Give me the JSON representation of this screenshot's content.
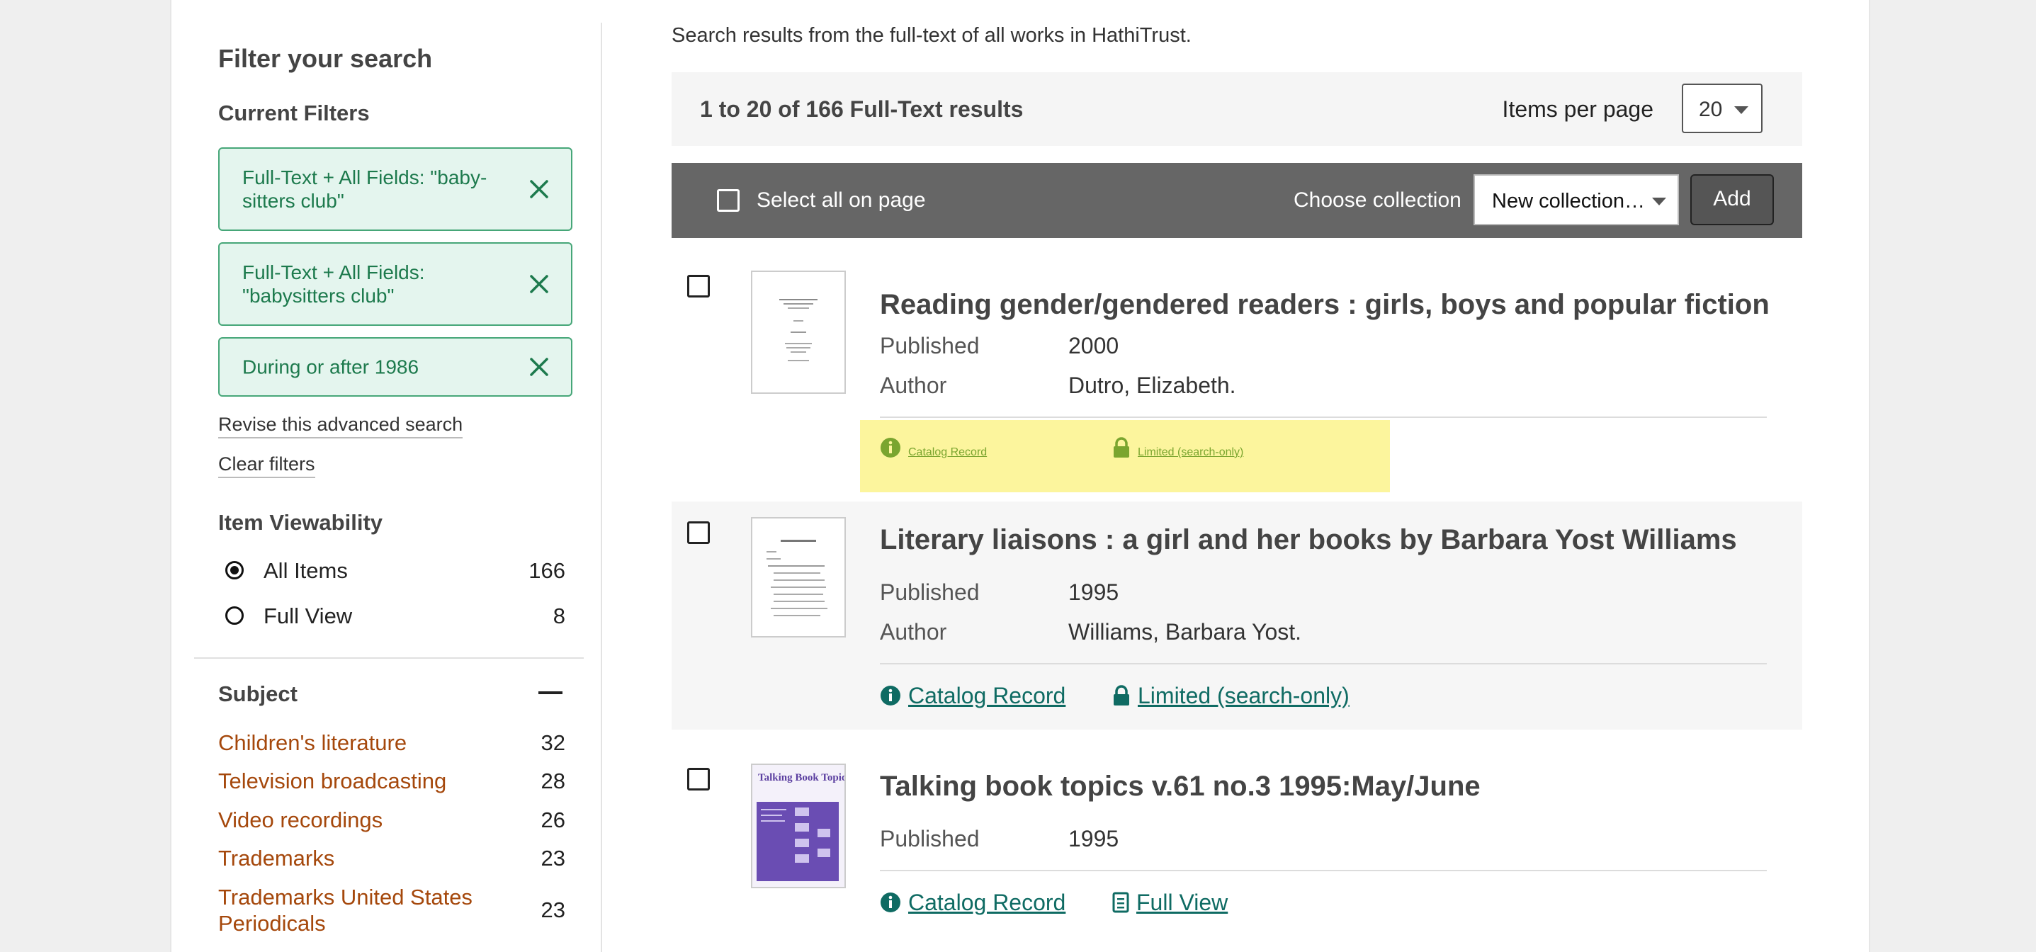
{
  "sidebar": {
    "heading": "Filter your search",
    "current_filters_heading": "Current Filters",
    "filters": [
      {
        "label": "Full-Text + All Fields: \"baby-sitters club\""
      },
      {
        "label": "Full-Text + All Fields: \"babysitters club\""
      },
      {
        "label": "During or after 1986"
      }
    ],
    "revise_link": "Revise this advanced search",
    "clear_link": "Clear filters",
    "viewability_heading": "Item Viewability",
    "viewability": [
      {
        "label": "All Items",
        "count": "166",
        "checked": true
      },
      {
        "label": "Full View",
        "count": "8",
        "checked": false
      }
    ],
    "subject_heading": "Subject",
    "subjects": [
      {
        "label": "Children's literature",
        "count": "32"
      },
      {
        "label": "Television broadcasting",
        "count": "28"
      },
      {
        "label": "Video recordings",
        "count": "26"
      },
      {
        "label": "Trademarks",
        "count": "23"
      },
      {
        "label": "Trademarks United States Periodicals",
        "count": "23"
      }
    ]
  },
  "main": {
    "intro": "Search results from the full-text of all works in HathiTrust.",
    "results_count": "1 to 20 of 166 Full-Text results",
    "items_per_page_label": "Items per page",
    "items_per_page_value": "20",
    "select_all_label": "Select all on page",
    "choose_collection_label": "Choose collection",
    "collection_value": "New collection…",
    "add_button": "Add",
    "results": [
      {
        "title": "Reading gender/gendered readers : girls, boys and popular fiction",
        "published_label": "Published",
        "published": "2000",
        "author_label": "Author",
        "author": "Dutro, Elizabeth.",
        "catalog_link": "Catalog Record",
        "access_link": "Limited (search-only)",
        "access_icon": "lock-icon"
      },
      {
        "title": "Literary liaisons : a girl and her books by Barbara Yost Williams",
        "published_label": "Published",
        "published": "1995",
        "author_label": "Author",
        "author": "Williams, Barbara Yost.",
        "catalog_link": "Catalog Record",
        "access_link": "Limited (search-only)",
        "access_icon": "lock-icon"
      },
      {
        "title": "Talking book topics v.61 no.3 1995:May/June",
        "published_label": "Published",
        "published": "1995",
        "catalog_link": "Catalog Record",
        "access_link": "Full View",
        "access_icon": "document-icon",
        "cover_text": "Talking Book Topics"
      }
    ]
  },
  "colors": {
    "filter_chip_bg": "#e4f5ee",
    "filter_chip_text": "#1d7a4d",
    "subject_link": "#a5480c",
    "result_link": "#0f6b63",
    "highlight": "#fcf59d",
    "action_bar": "#666666"
  }
}
